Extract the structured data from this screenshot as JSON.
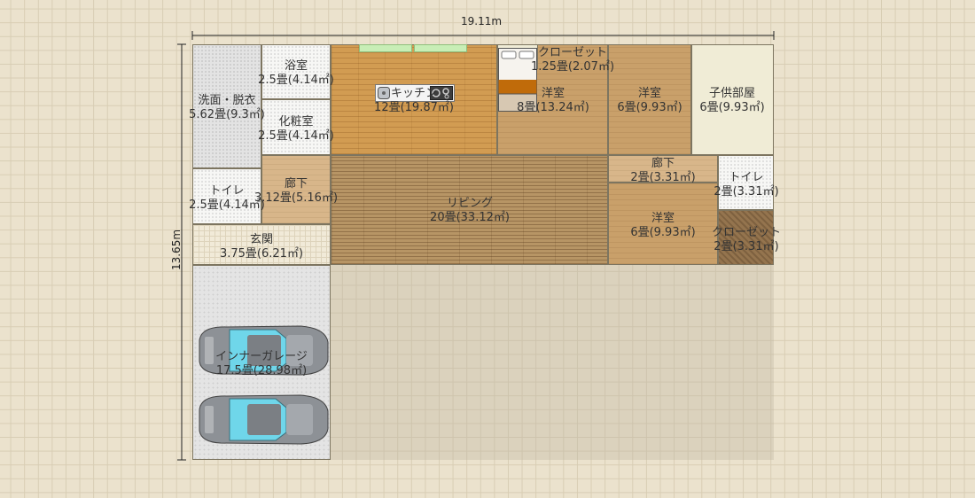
{
  "dimensions": {
    "width_label": "19.11m",
    "height_label": "13.65m"
  },
  "rooms": {
    "senmen": {
      "name": "洗面・脱衣",
      "area": "5.62畳(9.3㎡)"
    },
    "yokushitsu": {
      "name": "浴室",
      "area": "2.5畳(4.14㎡)"
    },
    "keshoushitsu": {
      "name": "化粧室",
      "area": "2.5畳(4.14㎡)"
    },
    "kitchen": {
      "name": "キッチン",
      "area": "12畳(19.87㎡)"
    },
    "closet_top": {
      "name": "クローゼット",
      "area": "1.25畳(2.07㎡)"
    },
    "youshitsu_bed": {
      "name": "洋室",
      "area": "8畳(13.24㎡)"
    },
    "youshitsu_mid": {
      "name": "洋室",
      "area": "6畳(9.93㎡)"
    },
    "kodomo": {
      "name": "子供部屋",
      "area": "6畳(9.93㎡)"
    },
    "toilet_left": {
      "name": "トイレ",
      "area": "2.5畳(4.14㎡)"
    },
    "rouka_left": {
      "name": "廊下",
      "area": "3.12畳(5.16㎡)"
    },
    "living": {
      "name": "リビング",
      "area": "20畳(33.12㎡)"
    },
    "rouka_right": {
      "name": "廊下",
      "area": "2畳(3.31㎡)"
    },
    "toilet_right": {
      "name": "トイレ",
      "area": "2畳(3.31㎡)"
    },
    "youshitsu_low": {
      "name": "洋室",
      "area": "6畳(9.93㎡)"
    },
    "closet_right": {
      "name": "クローゼット",
      "area": "2畳(3.31㎡)"
    },
    "genkan": {
      "name": "玄関",
      "area": "3.75畳(6.21㎡)"
    },
    "garage": {
      "name": "インナーガレージ",
      "area": "17.5畳(28.98㎡)"
    }
  },
  "icons": [
    "sink-icon",
    "stove-icon",
    "bed-icon",
    "car-icon"
  ]
}
